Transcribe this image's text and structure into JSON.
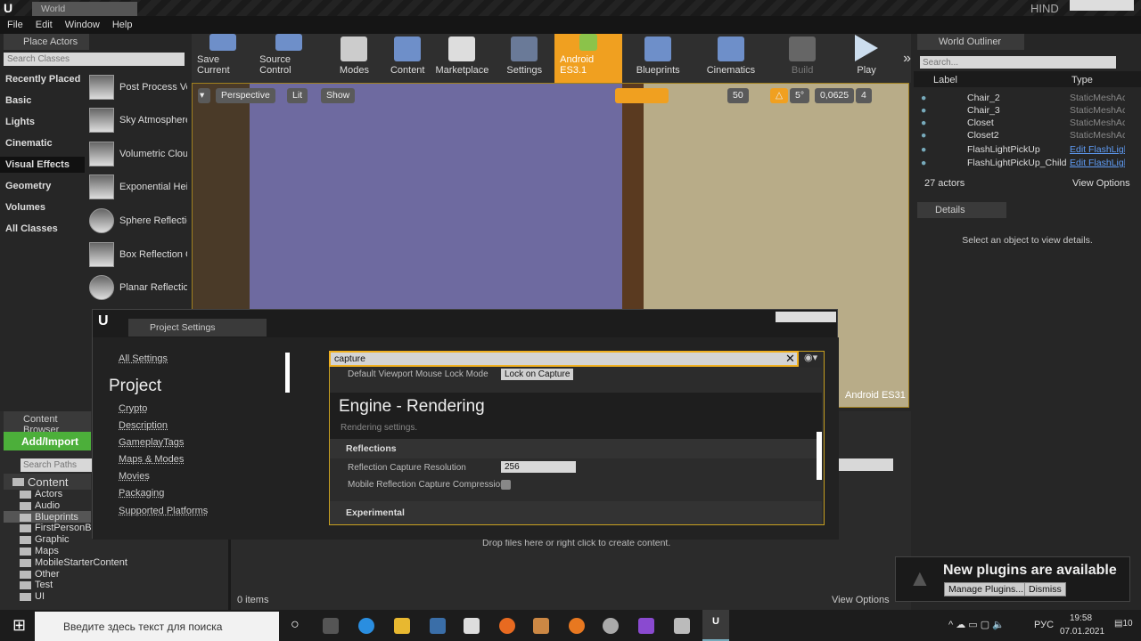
{
  "app": {
    "tab": "World",
    "hind": "HIND"
  },
  "menu": [
    "File",
    "Edit",
    "Window",
    "Help"
  ],
  "place_actors": {
    "tab": "Place Actors",
    "search_placeholder": "Search Classes",
    "categories": [
      "Recently Placed",
      "Basic",
      "Lights",
      "Cinematic",
      "Visual Effects",
      "Geometry",
      "Volumes",
      "All Classes"
    ],
    "selected_category": "Visual Effects",
    "items": [
      "Post Process Volume",
      "Sky Atmosphere",
      "Volumetric Cloud",
      "Exponential Height Fog",
      "Sphere Reflection Capture",
      "Box Reflection Capture",
      "Planar Reflection"
    ]
  },
  "toolbar": [
    "Save Current",
    "Source Control",
    "Modes",
    "Content",
    "Marketplace",
    "Settings",
    "Android ES3.1",
    "Blueprints",
    "Cinematics",
    "Build",
    "Play"
  ],
  "viewport": {
    "perspective": "Perspective",
    "lit": "Lit",
    "show": "Show",
    "grid": "50",
    "angle": "5°",
    "scale": "0,0625",
    "speed": "4",
    "feature_level": "Android ES31"
  },
  "outliner": {
    "tab": "World Outliner",
    "search_placeholder": "Search...",
    "col_label": "Label",
    "col_type": "Type",
    "rows": [
      {
        "label": "Chair_2",
        "type": "StaticMeshActor"
      },
      {
        "label": "Chair_3",
        "type": "StaticMeshActor"
      },
      {
        "label": "Closet",
        "type": "StaticMeshActor"
      },
      {
        "label": "Closet2",
        "type": "StaticMeshActor"
      },
      {
        "label": "FlashLightPickUp",
        "type": "Edit FlashLight"
      },
      {
        "label": "FlashLightPickUp_Child",
        "type": "Edit FlashLight"
      }
    ],
    "count": "27 actors",
    "view_options": "View Options"
  },
  "details": {
    "tab": "Details",
    "empty": "Select an object to view details."
  },
  "content_browser": {
    "tab": "Content Browser",
    "add_import": "Add/Import",
    "search_placeholder": "Search Paths",
    "root": "Content",
    "folders": [
      "Actors",
      "Audio",
      "Blueprints",
      "FirstPersonBP",
      "Graphic",
      "Maps",
      "MobileStarterContent",
      "Other",
      "Test",
      "UI"
    ],
    "selected": "Blueprints",
    "items_count": "0 items",
    "drop_hint": "Drop files here or right click to create content.",
    "view_options": "View Options"
  },
  "project_settings": {
    "title": "Project Settings",
    "all_settings": "All Settings",
    "section": "Project",
    "nav": [
      "Crypto",
      "Description",
      "GameplayTags",
      "Maps & Modes",
      "Movies",
      "Packaging",
      "Supported Platforms"
    ],
    "search_value": "capture",
    "mouse_lock_label": "Default Viewport Mouse Lock Mode",
    "mouse_lock_value": "Lock on Capture",
    "engine_heading": "Engine - Rendering",
    "engine_desc": "Rendering settings.",
    "reflections": "Reflections",
    "res_label": "Reflection Capture Resolution",
    "res_value": "256",
    "compression_label": "Mobile Reflection Capture Compression",
    "compression_checked": false,
    "experimental": "Experimental"
  },
  "notification": {
    "title": "New plugins are available",
    "manage": "Manage Plugins...",
    "dismiss": "Dismiss"
  },
  "taskbar": {
    "search_placeholder": "Введите здесь текст для поиска",
    "lang": "РУС",
    "time": "19:58",
    "date": "07.01.2021",
    "notif_count": "10"
  },
  "colors": {
    "accent": "#f0a020",
    "green": "#4caf3a",
    "link": "#5f9cf5"
  }
}
